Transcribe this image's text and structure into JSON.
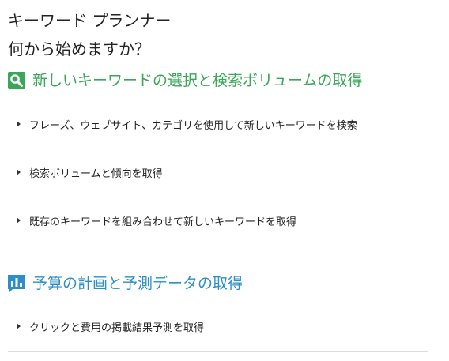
{
  "page": {
    "title": "キーワード プランナー",
    "question": "何から始めますか？"
  },
  "sections": [
    {
      "title": "新しいキーワードの選択と検索ボリュームの取得",
      "icon": "search-icon",
      "color": "#3aa657",
      "options": [
        {
          "label": "フレーズ、ウェブサイト、カテゴリを使用して新しいキーワードを検索"
        },
        {
          "label": "検索ボリュームと傾向を取得"
        },
        {
          "label": "既存のキーワードを組み合わせて新しいキーワードを取得"
        }
      ]
    },
    {
      "title": "予算の計画と予測データの取得",
      "icon": "bar-chart-icon",
      "color": "#2b8fc8",
      "options": [
        {
          "label": "クリックと費用の掲載結果予測を取得"
        }
      ]
    }
  ]
}
